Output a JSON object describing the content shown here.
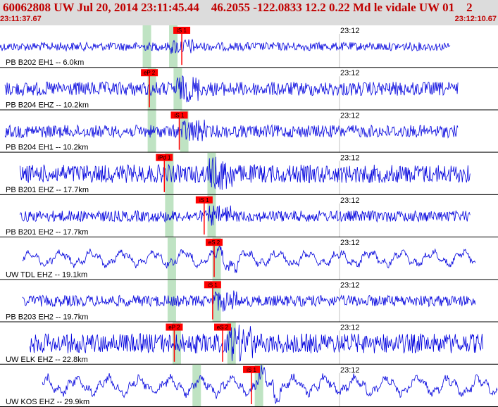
{
  "header": {
    "title": "60062808 UW Jul 20, 2014 23:11:45.44    46.2055 -122.0833 12.2 0.22 Md le vidale UW 01    2",
    "start_time": "23:11:37.67",
    "end_time": "23:12:10.67"
  },
  "colors": {
    "header_bg": "#dcdcdc",
    "header_text": "#c00000",
    "trace": "#0000dd",
    "pick_box": "#ff0000",
    "window": "#bfe3c3",
    "separator": "#000000"
  },
  "minute_label": "23:12",
  "traces": [
    {
      "label": "PB B202 EH1 -- 6.0km",
      "amp": 6,
      "style": "noise",
      "extent": [
        0.0,
        0.905
      ],
      "windows": [
        0.295,
        0.348
      ],
      "picks": [
        {
          "text": "iS 1",
          "pos": 0.365
        }
      ]
    },
    {
      "label": "PB B204 EHZ -- 10.2km",
      "amp": 10,
      "style": "noise",
      "extent": [
        0.01,
        0.92
      ],
      "windows": [
        0.305,
        0.357
      ],
      "picks": [
        {
          "text": "eP 2",
          "pos": 0.3
        }
      ]
    },
    {
      "label": "PB B204 EH1 -- 10.2km",
      "amp": 9,
      "style": "noise",
      "extent": [
        0.01,
        0.92
      ],
      "windows": [
        0.305,
        0.37
      ],
      "picks": [
        {
          "text": "iS 1",
          "pos": 0.36
        }
      ]
    },
    {
      "label": "PB B201 EHZ -- 17.7km",
      "amp": 13,
      "style": "noise",
      "extent": [
        0.04,
        0.945
      ],
      "windows": [
        0.34,
        0.425
      ],
      "picks": [
        {
          "text": "iPd 1",
          "pos": 0.33
        }
      ]
    },
    {
      "label": "PB B201 EH2 -- 17.7km",
      "amp": 8,
      "style": "noise",
      "extent": [
        0.04,
        0.945
      ],
      "windows": [
        0.34,
        0.425
      ],
      "picks": [
        {
          "text": "iS 1",
          "pos": 0.41
        }
      ]
    },
    {
      "label": "UW TDL EHZ -- 19.1km",
      "amp": 14,
      "style": "wave",
      "extent": [
        0.045,
        0.955
      ],
      "windows": [
        0.345,
        0.435
      ],
      "picks": [
        {
          "text": "eS 2",
          "pos": 0.43
        }
      ]
    },
    {
      "label": "PB B203 EH2 -- 19.7km",
      "amp": 8,
      "style": "noise",
      "extent": [
        0.045,
        0.955
      ],
      "windows": [
        0.345,
        0.435
      ],
      "picks": [
        {
          "text": "iS 1",
          "pos": 0.427
        }
      ]
    },
    {
      "label": "UW ELK EHZ -- 22.8km",
      "amp": 14,
      "style": "noise",
      "extent": [
        0.06,
        0.97
      ],
      "windows": [
        0.355,
        0.465
      ],
      "picks": [
        {
          "text": "eP 2",
          "pos": 0.35
        },
        {
          "text": "eS 2",
          "pos": 0.447
        }
      ]
    },
    {
      "label": "UW KOS EHZ -- 29.9km",
      "amp": 17,
      "style": "wave",
      "extent": [
        0.085,
        1.0
      ],
      "windows": [
        0.395,
        0.52
      ],
      "picks": [
        {
          "text": "iS 1",
          "pos": 0.505
        }
      ]
    }
  ]
}
